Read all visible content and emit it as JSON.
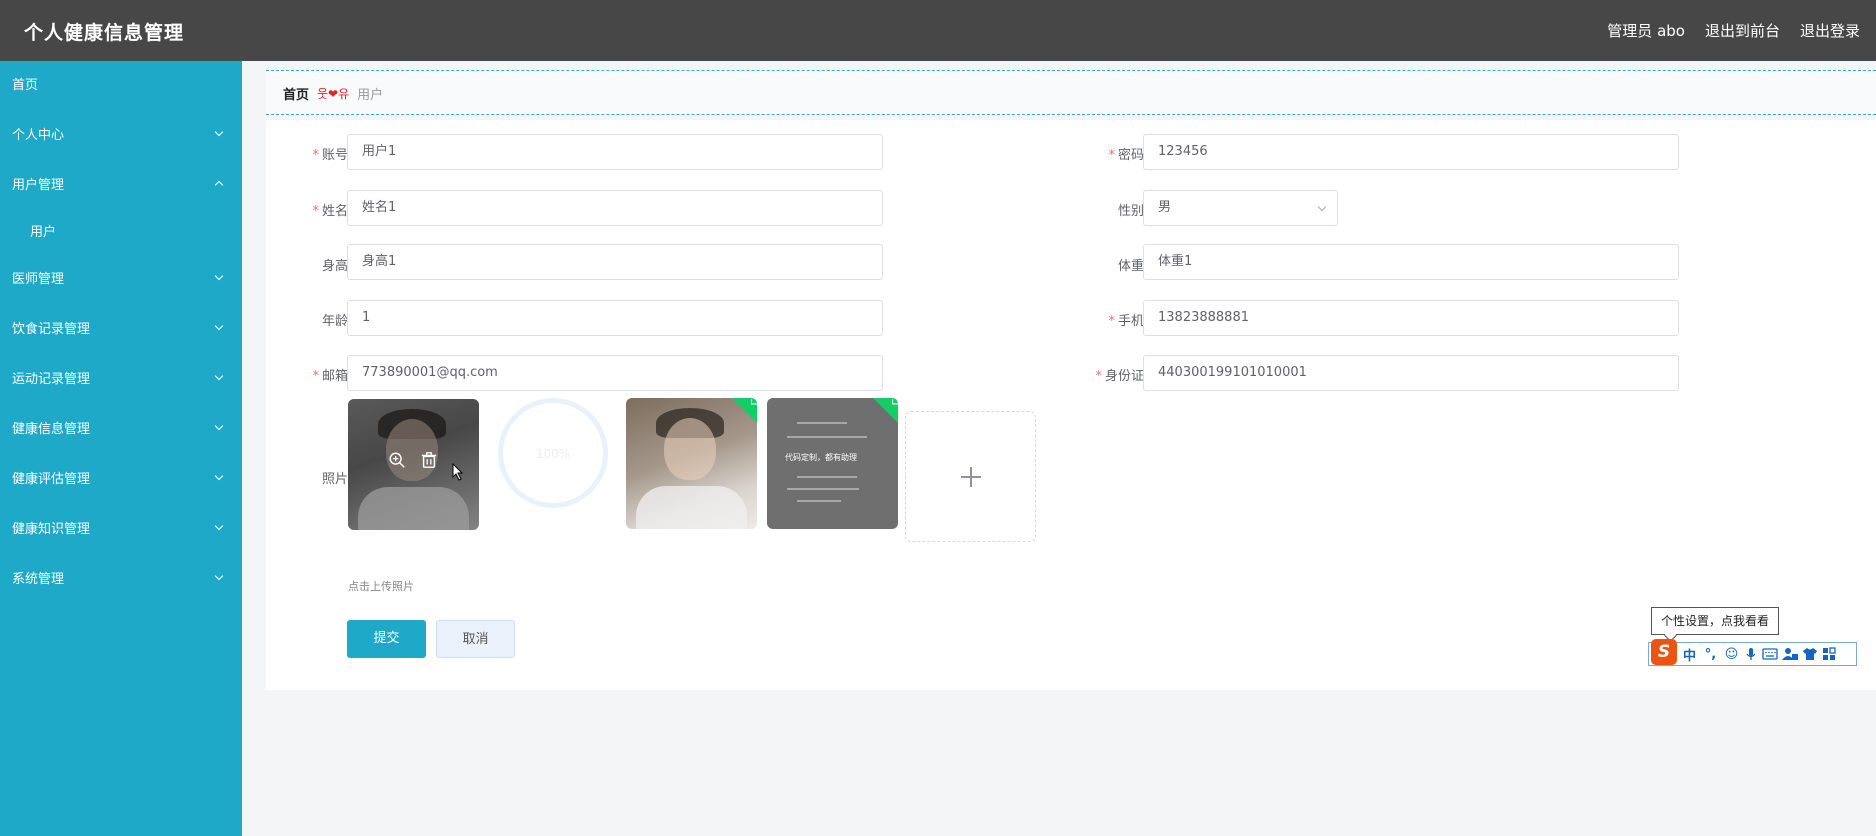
{
  "header": {
    "app_title": "个人健康信息管理",
    "user_label": "管理员 abo",
    "front_link": "退出到前台",
    "logout_link": "退出登录"
  },
  "sidebar": {
    "items": [
      {
        "label": "首页"
      },
      {
        "label": "个人中心"
      },
      {
        "label": "用户管理"
      },
      {
        "label": "用户"
      },
      {
        "label": "医师管理"
      },
      {
        "label": "饮食记录管理"
      },
      {
        "label": "运动记录管理"
      },
      {
        "label": "健康信息管理"
      },
      {
        "label": "健康评估管理"
      },
      {
        "label": "健康知识管理"
      },
      {
        "label": "系统管理"
      }
    ]
  },
  "breadcrumb": {
    "home": "首页",
    "separator": "웃❤유",
    "current": "用户"
  },
  "form": {
    "account": {
      "label": "账号",
      "value": "用户1"
    },
    "password": {
      "label": "密码",
      "value": "123456"
    },
    "name": {
      "label": "姓名",
      "value": "姓名1"
    },
    "gender": {
      "label": "性别",
      "value": "男"
    },
    "height": {
      "label": "身高",
      "value": "身高1"
    },
    "weight": {
      "label": "体重",
      "value": "体重1"
    },
    "age": {
      "label": "年龄",
      "value": "1"
    },
    "phone": {
      "label": "手机",
      "value": "13823888881"
    },
    "email": {
      "label": "邮箱",
      "value": "773890001@qq.com"
    },
    "id_card": {
      "label": "身份证",
      "value": "440300199101010001"
    },
    "photo": {
      "label": "照片",
      "tip": "点击上传照片",
      "loading_text": "100%",
      "doc_caption": "代码定制，都有助理"
    },
    "submit_label": "提交",
    "cancel_label": "取消",
    "required_mark": "*"
  },
  "ime": {
    "tooltip": "个性设置，点我看看",
    "logo": "S",
    "mode": "中"
  },
  "colors": {
    "topbar": "#474747",
    "sidebar": "#1ea9c9",
    "primary": "#1ea9c9",
    "required": "#f56c6c",
    "success": "#13ce66"
  }
}
